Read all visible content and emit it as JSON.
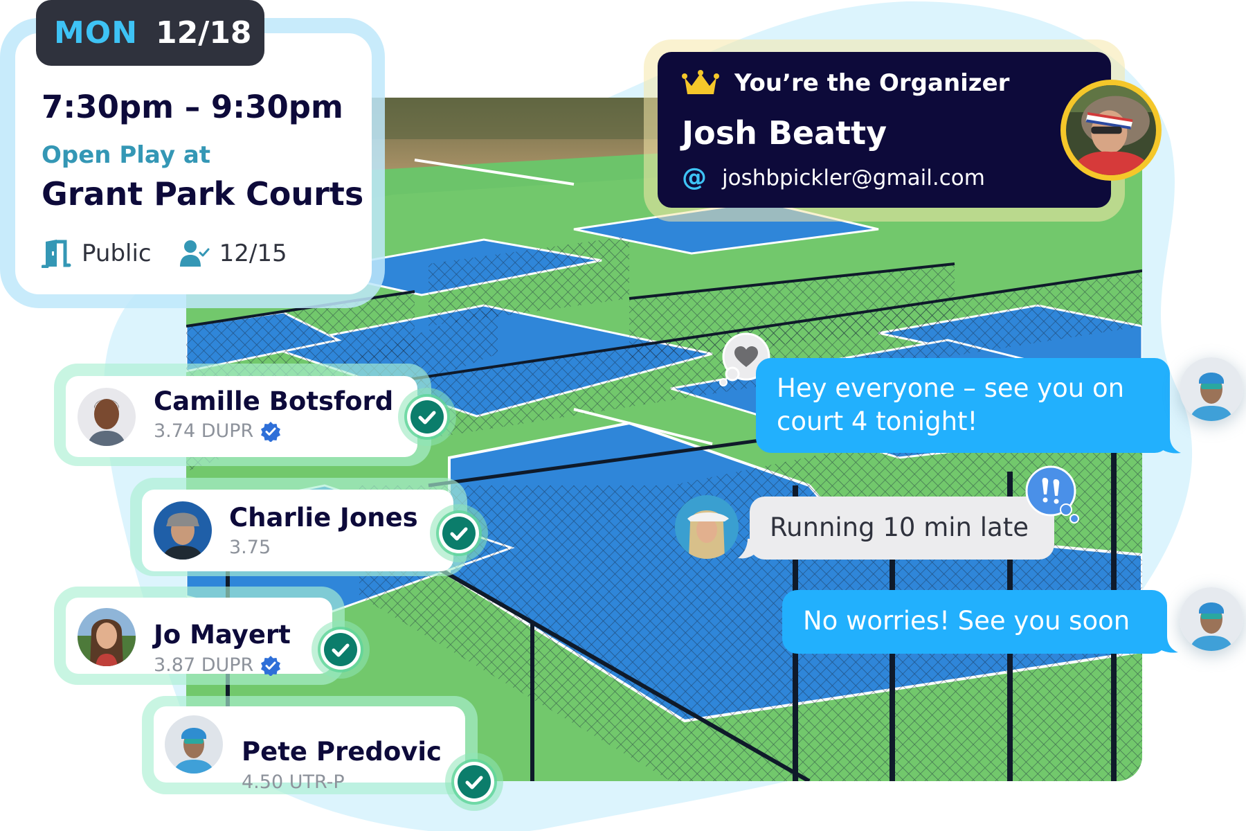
{
  "event": {
    "day_of_week": "MON",
    "date": "12/18",
    "time_range": "7:30pm – 9:30pm",
    "subtitle": "Open Play at",
    "venue": "Grant Park Courts",
    "visibility": "Public",
    "attendance": "12/15",
    "icons": {
      "visibility": "door-icon",
      "attendance": "user-check-icon"
    }
  },
  "organizer": {
    "role_label": "You’re the Organizer",
    "name": "Josh Beatty",
    "email": "joshbpickler@gmail.com",
    "icons": {
      "role": "crown-icon",
      "email": "at-sign-icon"
    }
  },
  "players": [
    {
      "name": "Camille Botsford",
      "rating": "3.74 DUPR",
      "verified": true,
      "confirmed": true
    },
    {
      "name": "Charlie Jones",
      "rating": "3.75",
      "verified": false,
      "confirmed": true
    },
    {
      "name": "Jo Mayert",
      "rating": "3.87 DUPR",
      "verified": true,
      "confirmed": true
    },
    {
      "name": "Pete Predovic",
      "rating": "4.50 UTR-P",
      "verified": false,
      "confirmed": true
    }
  ],
  "chat": {
    "messages": [
      {
        "text": "Hey everyone – see you on court 4 tonight!",
        "line1": "Hey everyone – see you on",
        "line2": "court 4 tonight!",
        "side": "right",
        "reaction": "heart-icon"
      },
      {
        "text": "Running 10 min late",
        "side": "left",
        "reaction": "double-exclamation-icon"
      },
      {
        "text": "No worries! See you soon",
        "side": "right",
        "reaction": null
      }
    ]
  },
  "colors": {
    "navy": "#0d0a3a",
    "accent_cyan": "#3ec3f5",
    "teal_text": "#3497b5",
    "chat_blue": "#22b0fd",
    "check_green": "#0b7d6b",
    "crown_gold": "#f5c72a",
    "verified_blue": "#2e6fd8"
  }
}
